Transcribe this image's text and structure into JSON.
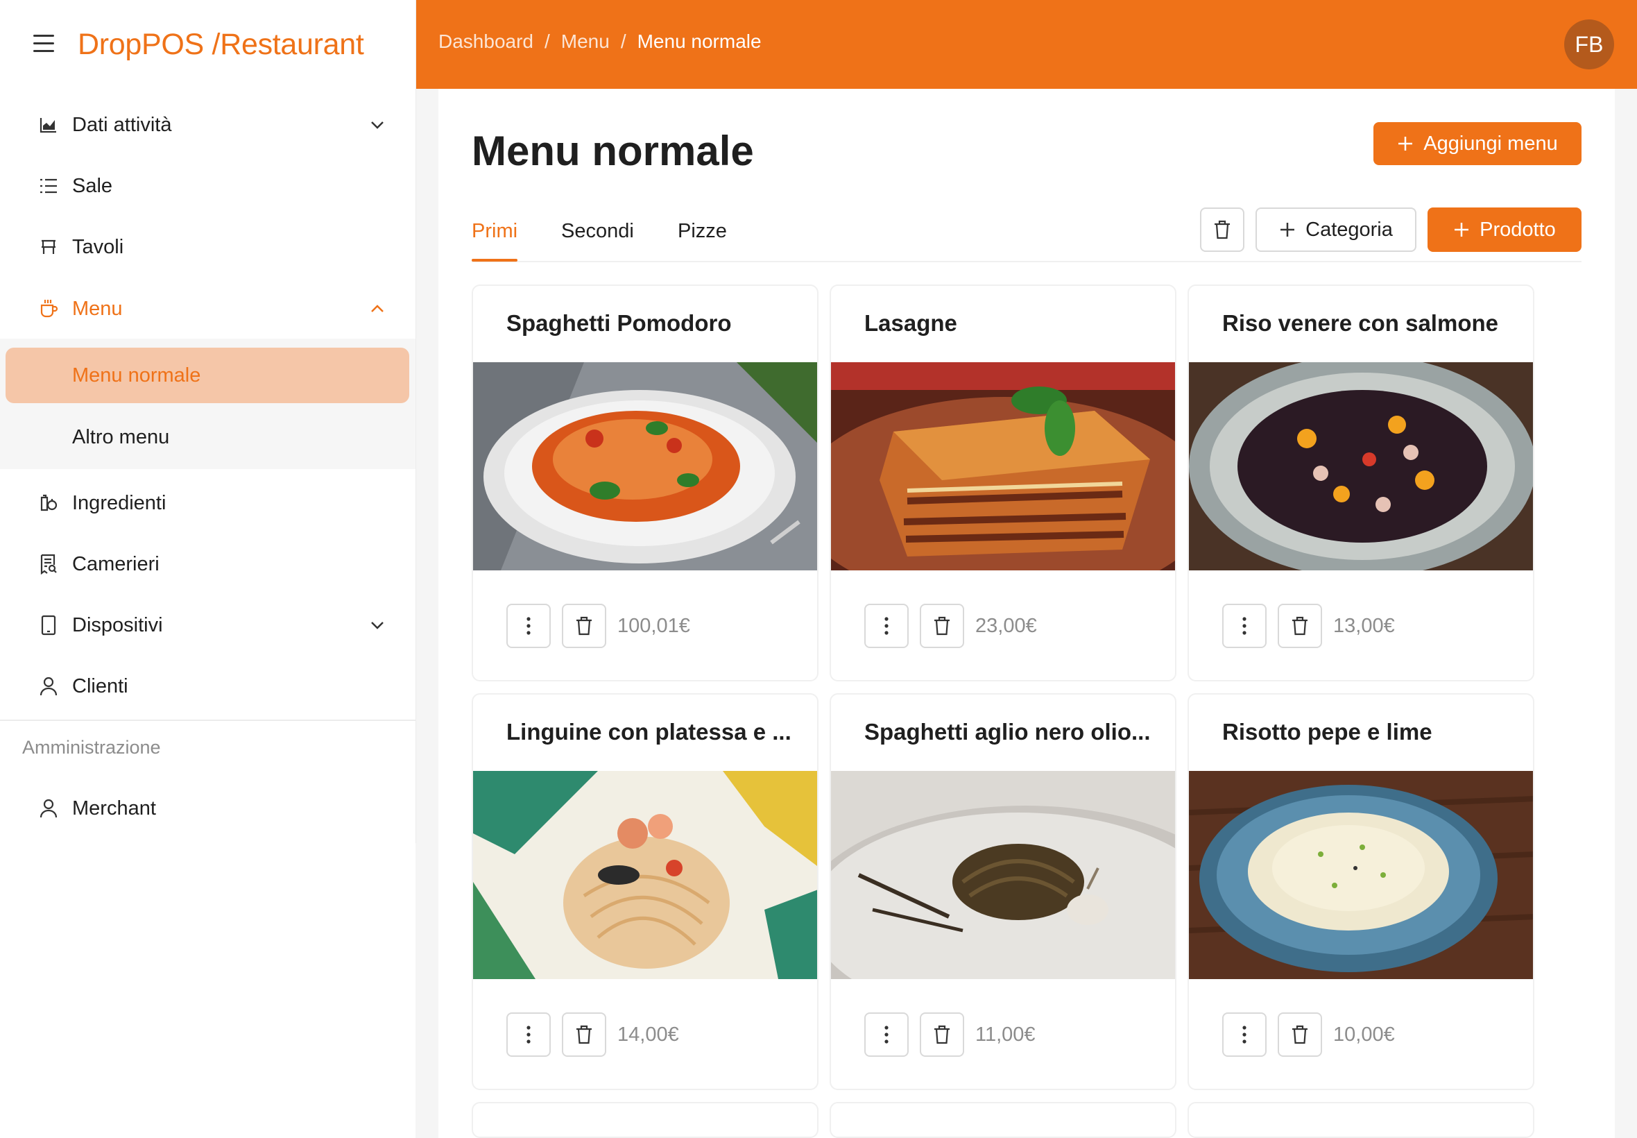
{
  "brand": {
    "title": "DropPOS /Restaurant"
  },
  "sidebar": {
    "items": [
      {
        "label": "Dati attività"
      },
      {
        "label": "Sale"
      },
      {
        "label": "Tavoli"
      },
      {
        "label": "Menu"
      },
      {
        "label": "Ingredienti"
      },
      {
        "label": "Camerieri"
      },
      {
        "label": "Dispositivi"
      },
      {
        "label": "Clienti"
      }
    ],
    "submenu": [
      {
        "label": "Menu normale"
      },
      {
        "label": "Altro menu"
      }
    ],
    "section": "Amministrazione",
    "admin_items": [
      {
        "label": "Merchant"
      }
    ]
  },
  "header": {
    "breadcrumb": [
      "Dashboard",
      "Menu",
      "Menu normale"
    ],
    "separator": "/",
    "avatar": "FB"
  },
  "main": {
    "title": "Menu normale",
    "add_menu_label": "Aggiungi menu",
    "tabs": [
      {
        "label": "Primi"
      },
      {
        "label": "Secondi"
      },
      {
        "label": "Pizze"
      }
    ],
    "category_label": "Categoria",
    "product_label": "Prodotto",
    "products": [
      {
        "name": "Spaghetti Pomodoro",
        "price": "100,01€"
      },
      {
        "name": "Lasagne",
        "price": "23,00€"
      },
      {
        "name": "Riso venere con salmone",
        "price": "13,00€"
      },
      {
        "name": "Linguine con platessa e ...",
        "price": "14,00€"
      },
      {
        "name": "Spaghetti aglio nero olio...",
        "price": "11,00€"
      },
      {
        "name": "Risotto pepe e lime",
        "price": "10,00€"
      }
    ]
  },
  "colors": {
    "accent": "#ef7218",
    "accent_light": "#f5c6a8",
    "avatar_bg": "#b45a1c"
  },
  "icons": [
    "menu-icon",
    "chart-icon",
    "list-icon",
    "table-icon",
    "coffee-icon",
    "ingredients-icon",
    "receipt-icon",
    "device-icon",
    "user-icon",
    "chevron-down-icon",
    "chevron-up-icon",
    "plus-icon",
    "trash-icon",
    "more-vertical-icon"
  ]
}
